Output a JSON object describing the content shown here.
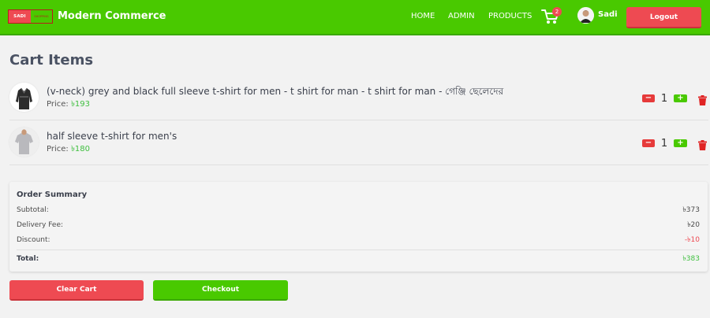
{
  "navbar": {
    "logo_text_left": "SADI",
    "logo_text_right": "SHOPPING",
    "brand": "Modern Commerce",
    "links": [
      "HOME",
      "ADMIN",
      "PRODUCTS"
    ],
    "cart_icon": "cart-icon",
    "cart_count": "2",
    "username": "Sadi",
    "logout_label": "Logout",
    "bg_color": "#49c900"
  },
  "page": {
    "title": "Cart Items"
  },
  "cart": {
    "items": [
      {
        "name": "(v-neck) grey and black full sleeve t-shirt for men - t shirt for man - t shirt for man - গেঞ্জি ছেলেদের",
        "price_label": "Price:",
        "price": "৳193",
        "quantity": "1",
        "minus": "−",
        "plus": "+"
      },
      {
        "name": "half sleeve t-shirt for men's",
        "price_label": "Price:",
        "price": "৳180",
        "quantity": "1",
        "minus": "−",
        "plus": "+"
      }
    ]
  },
  "summary": {
    "title": "Order Summary",
    "subtotal_label": "Subtotal:",
    "subtotal": "৳373",
    "delivery_label": "Delivery Fee:",
    "delivery": "৳20",
    "discount_label": "Discount:",
    "discount": "-৳10",
    "total_label": "Total:",
    "total": "৳383"
  },
  "actions": {
    "clear_label": "Clear Cart",
    "checkout_label": "Checkout"
  },
  "colors": {
    "accent_green": "#49c900",
    "danger_red": "#ee4a52",
    "price_green": "#3fbf3f"
  }
}
